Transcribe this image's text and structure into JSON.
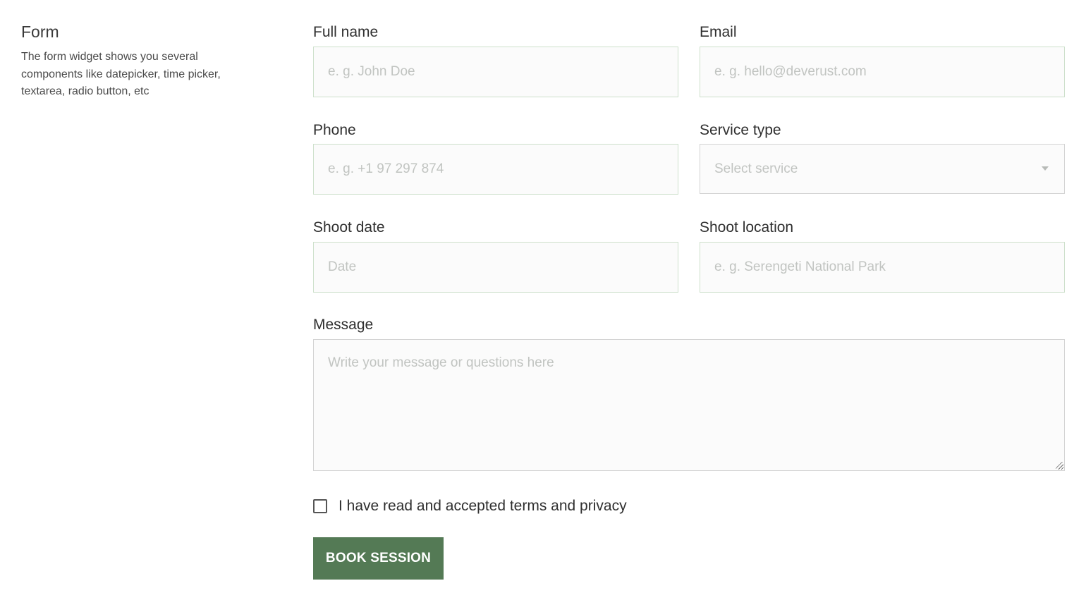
{
  "intro": {
    "title": "Form",
    "description": "The form widget shows you several components like datepicker, time picker, textarea, radio button, etc"
  },
  "form": {
    "full_name": {
      "label": "Full name",
      "placeholder": "e. g. John Doe",
      "value": ""
    },
    "email": {
      "label": "Email",
      "placeholder": "e. g. hello@deverust.com",
      "value": ""
    },
    "phone": {
      "label": "Phone",
      "placeholder": "e. g. +1 97 297 874",
      "value": ""
    },
    "service_type": {
      "label": "Service type",
      "placeholder": "Select service",
      "icon": "chevron-down-icon"
    },
    "shoot_date": {
      "label": "Shoot date",
      "placeholder": "Date",
      "value": ""
    },
    "shoot_location": {
      "label": "Shoot location",
      "placeholder": "e. g. Serengeti National Park",
      "value": ""
    },
    "message": {
      "label": "Message",
      "placeholder": "Write your message or questions here",
      "value": ""
    },
    "terms": {
      "label": "I have read and accepted terms and privacy",
      "checked": false
    },
    "submit_label": "BOOK SESSION"
  },
  "colors": {
    "accent": "#547a55",
    "input_background": "#fbfbfb",
    "input_border": "#cde0cb",
    "placeholder_text": "#c1c4c1"
  }
}
